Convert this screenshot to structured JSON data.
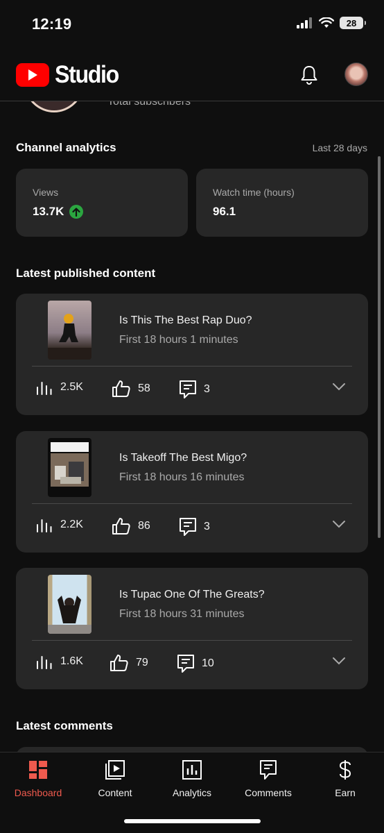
{
  "status_bar": {
    "time": "12:19",
    "battery": "28"
  },
  "header": {
    "brand": "Studio"
  },
  "scrolled_remnant": {
    "text": "Total subscribers"
  },
  "channel_analytics": {
    "title": "Channel analytics",
    "period": "Last 28 days",
    "metrics": [
      {
        "label": "Views",
        "value": "13.7K",
        "trend": "up"
      },
      {
        "label": "Watch time (hours)",
        "value": "96.1"
      }
    ]
  },
  "latest_content": {
    "title": "Latest published content",
    "videos": [
      {
        "title": "Is This The Best Rap Duo?",
        "subtitle": "First 18 hours 1 minutes",
        "views": "2.5K",
        "likes": "58",
        "comments": "3"
      },
      {
        "title": "Is Takeoff The Best Migo?",
        "subtitle": "First 18 hours 16 minutes",
        "views": "2.2K",
        "likes": "86",
        "comments": "3",
        "thumb_caption": "When Takeoff Did The Whole Interview In ..."
      },
      {
        "title": "Is Tupac One Of The Greats?",
        "subtitle": "First 18 hours 31 minutes",
        "views": "1.6K",
        "likes": "79",
        "comments": "10"
      }
    ]
  },
  "latest_comments": {
    "title": "Latest comments"
  },
  "bottom_nav": {
    "items": [
      {
        "label": "Dashboard",
        "icon": "dashboard-icon",
        "active": true
      },
      {
        "label": "Content",
        "icon": "content-icon"
      },
      {
        "label": "Analytics",
        "icon": "analytics-icon"
      },
      {
        "label": "Comments",
        "icon": "comments-icon"
      },
      {
        "label": "Earn",
        "icon": "dollar-icon"
      }
    ]
  },
  "colors": {
    "accent": "#ef5a4e",
    "brand_red": "#ff0000",
    "card": "#272727",
    "background": "#0f0f0f",
    "up_green": "#2ba640"
  }
}
